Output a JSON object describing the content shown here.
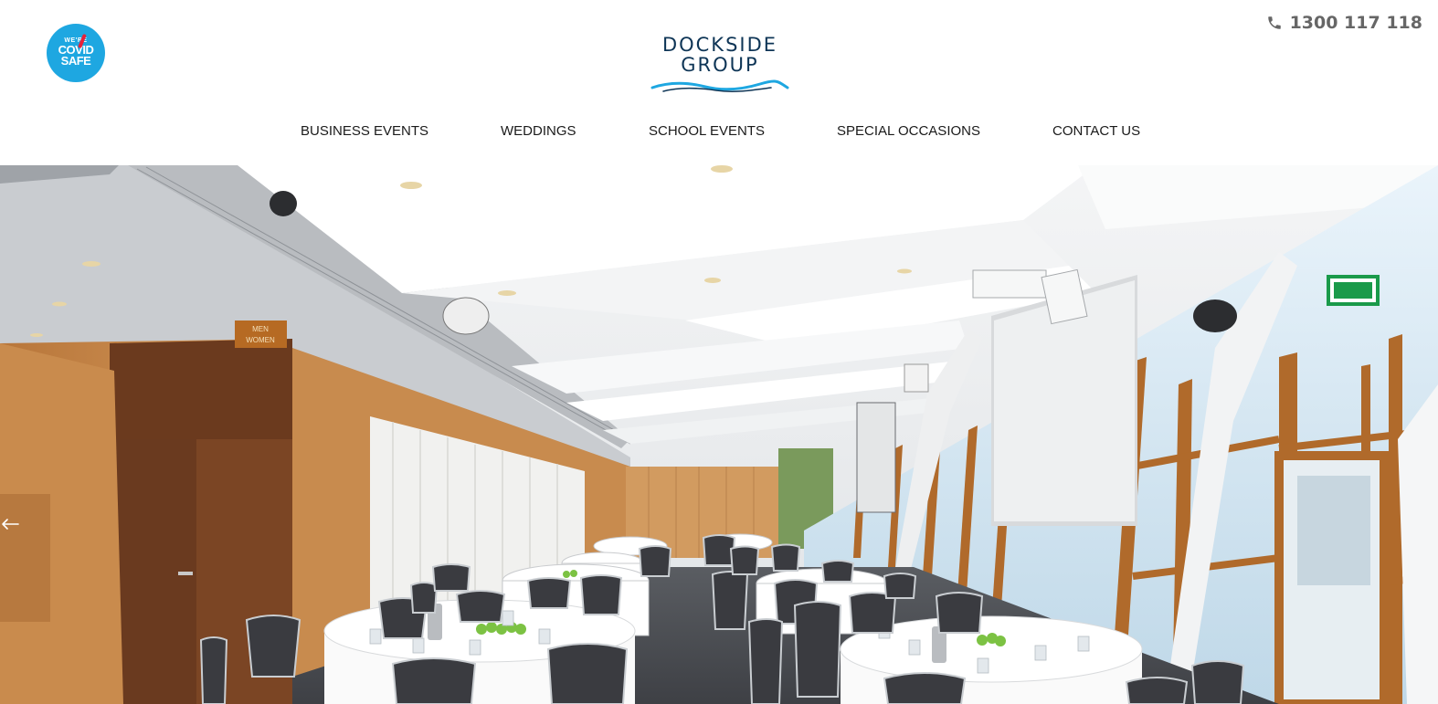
{
  "header": {
    "covid_badge": {
      "line0": "WE'RE",
      "line1": "COVID",
      "line2": "SAFE",
      "color": "#1ea7e1"
    },
    "logo": {
      "line1": "DOCKSIDE",
      "line2": "GROUP",
      "color": "#0e3556",
      "wave_color": "#1ea7e1"
    },
    "phone": {
      "icon": "phone-icon",
      "number": "1300 117 118"
    }
  },
  "nav": {
    "items": [
      {
        "label": "BUSINESS EVENTS"
      },
      {
        "label": "WEDDINGS"
      },
      {
        "label": "SCHOOL EVENTS"
      },
      {
        "label": "SPECIAL OCCASIONS"
      },
      {
        "label": "CONTACT US"
      }
    ]
  },
  "hero": {
    "arrow_icon": "arrow-left-icon",
    "sign_text": "MEN WOMEN"
  }
}
